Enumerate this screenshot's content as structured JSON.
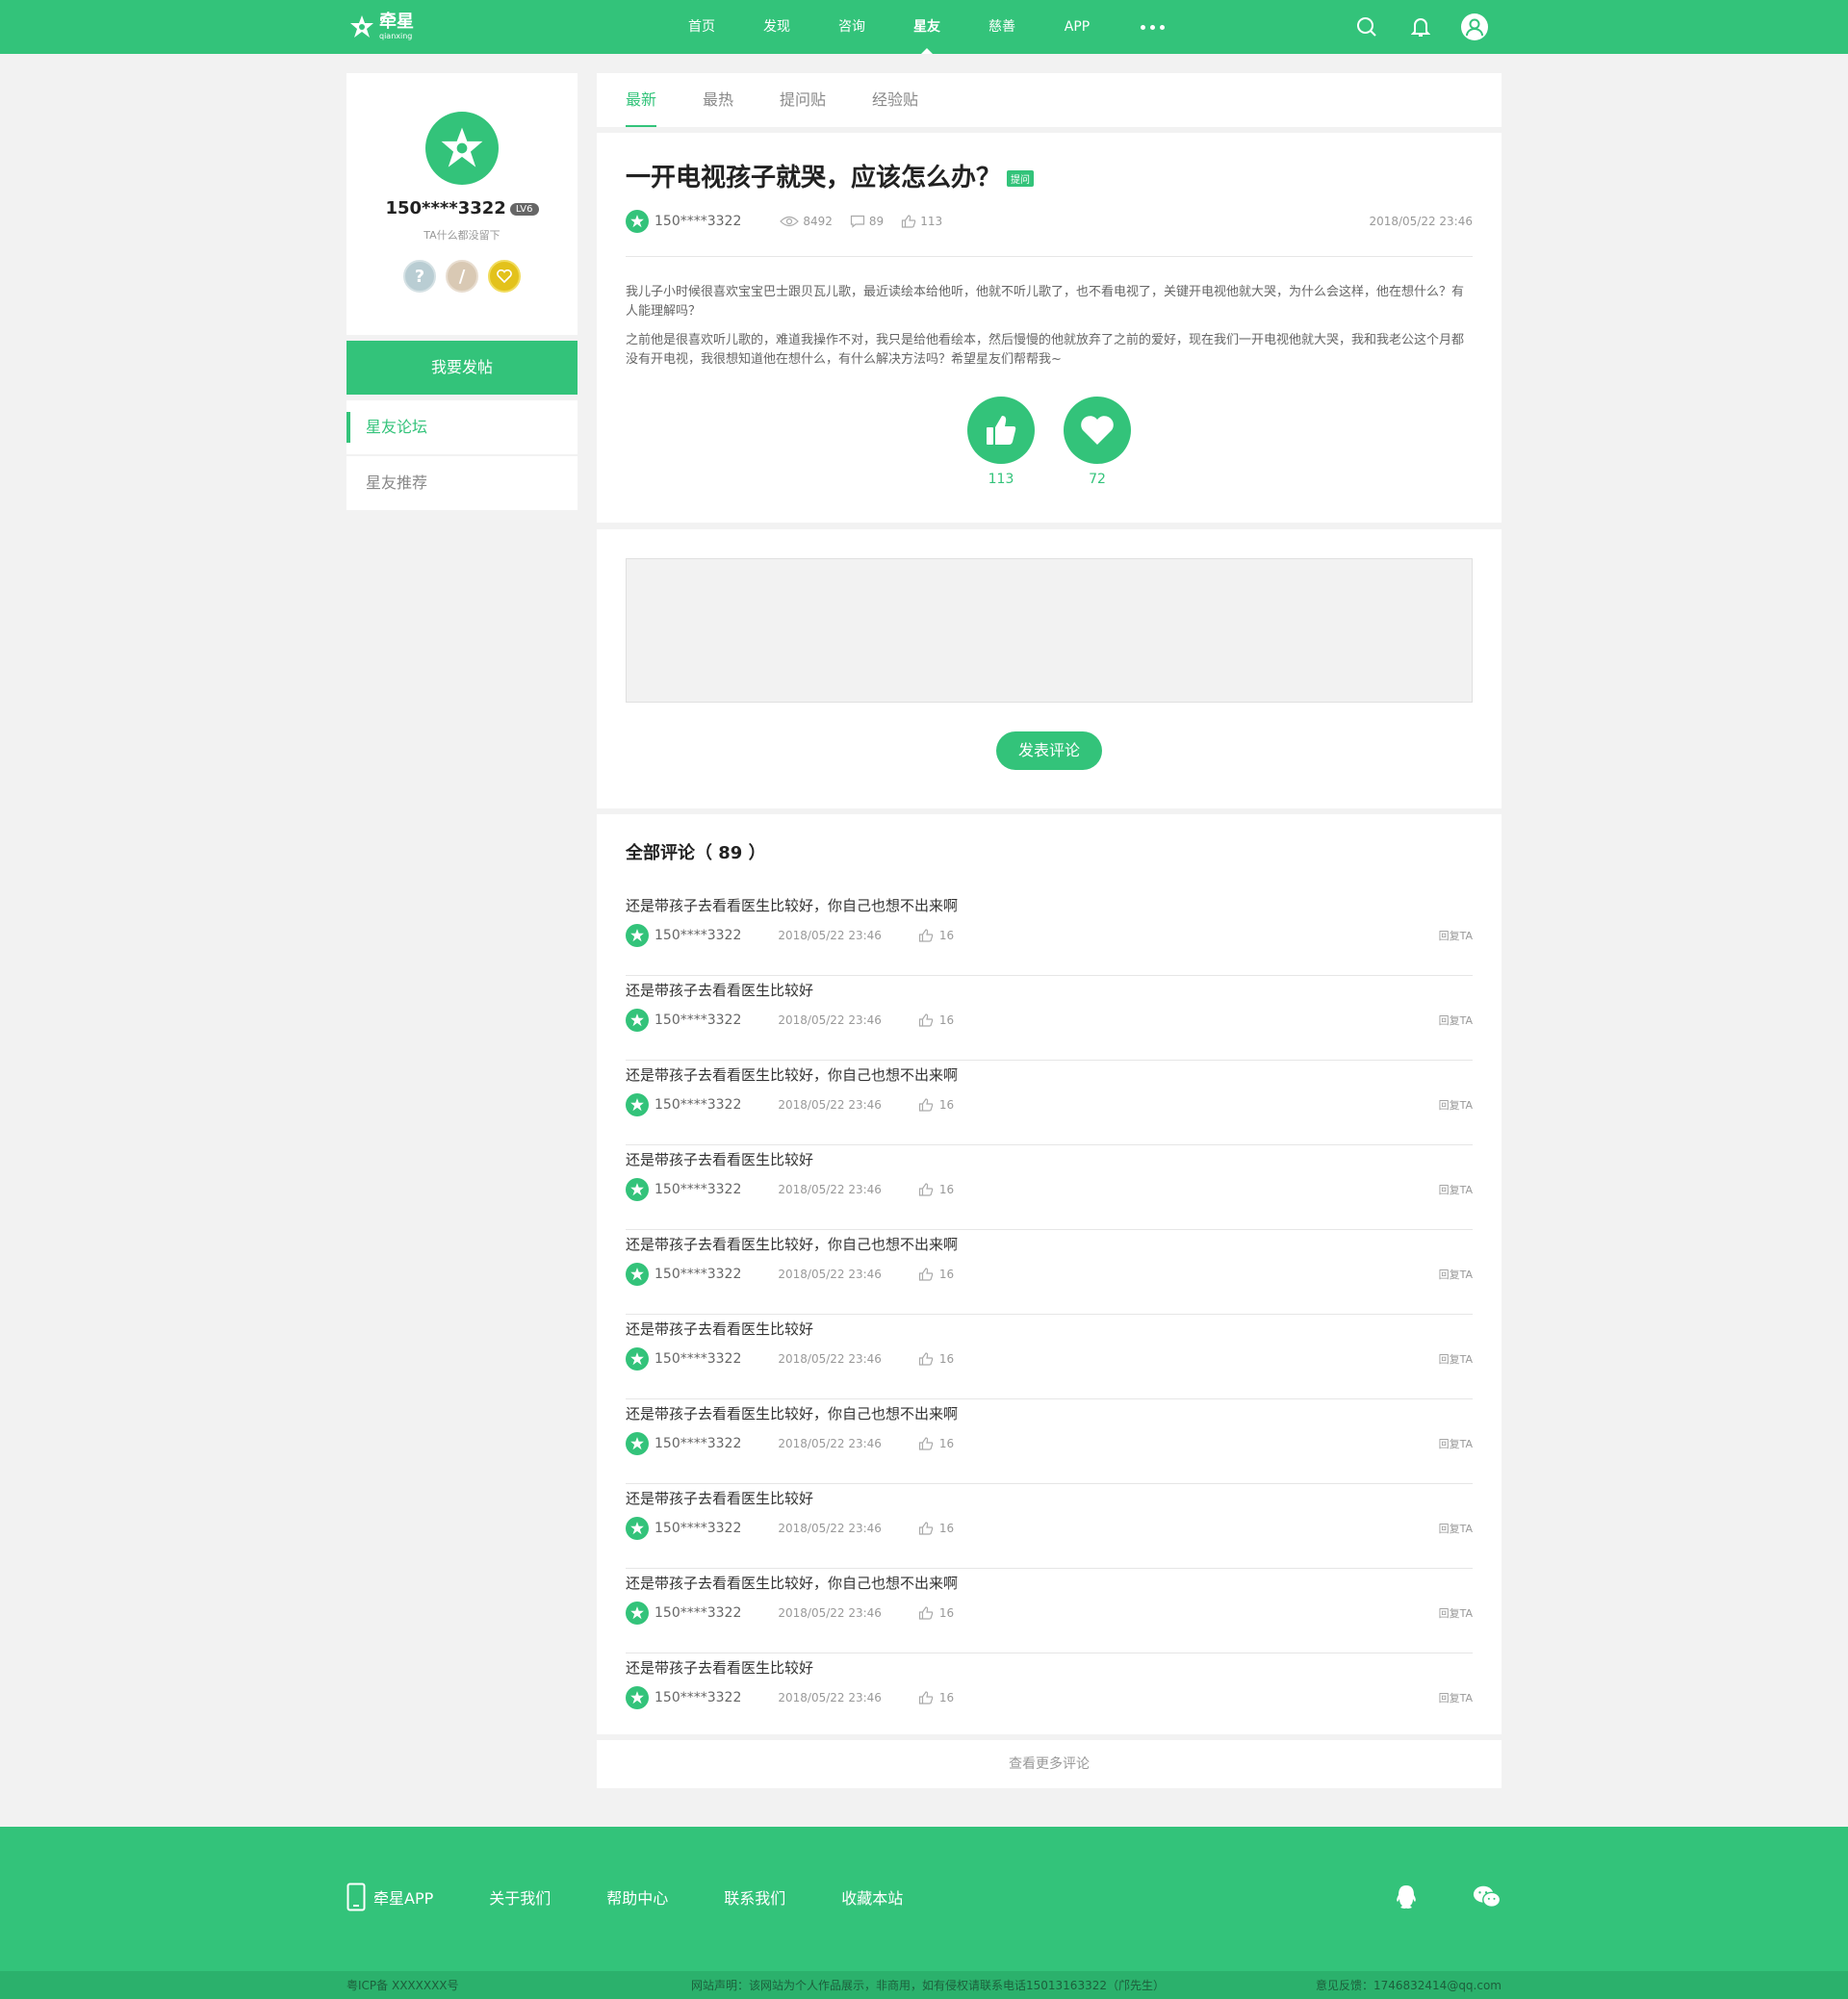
{
  "colors": {
    "accent": "#33c37a",
    "accent_dark": "#2bb16c",
    "page_bg": "#f2f2f2"
  },
  "header": {
    "logo_cn": "牵星",
    "logo_en": "qianxing",
    "nav": [
      "首页",
      "发现",
      "咨询",
      "星友",
      "慈善",
      "APP"
    ],
    "active_nav": "星友",
    "icons": [
      "search-icon",
      "bell-icon",
      "user-icon"
    ]
  },
  "sidebar": {
    "name": "150****3322",
    "level": "LV6",
    "sign": "TA什么都没留下",
    "medals": [
      "question-medal",
      "pencil-medal",
      "heart-medal"
    ],
    "post_button": "我要发帖",
    "menu": [
      {
        "label": "星友论坛",
        "active": true
      },
      {
        "label": "星友推荐",
        "active": false
      }
    ]
  },
  "tabs": [
    {
      "label": "最新",
      "active": true
    },
    {
      "label": "最热",
      "active": false
    },
    {
      "label": "提问贴",
      "active": false
    },
    {
      "label": "经验贴",
      "active": false
    }
  ],
  "post": {
    "title": "一开电视孩子就哭，应该怎么办？",
    "tag": "提问",
    "author": "150****3322",
    "views": "8492",
    "comments": "89",
    "likes": "113",
    "date": "2018/05/22  23:46",
    "body": [
      "我儿子小时候很喜欢宝宝巴士跟贝瓦儿歌，最近读绘本给他听，他就不听儿歌了，也不看电视了，关键开电视他就大哭，为什么会这样，他在想什么？有人能理解吗？",
      "之前他是很喜欢听儿歌的，难道我操作不对，我只是给他看绘本，然后慢慢的他就放弃了之前的爱好，现在我们一开电视他就大哭，我和我老公这个月都没有开电视，我很想知道他在想什么，有什么解决方法吗？希望星友们帮帮我~"
    ],
    "like_count": "113",
    "fav_count": "72"
  },
  "comment_box": {
    "placeholder": "",
    "submit": "发表评论"
  },
  "comments": {
    "title": "全部评论（ 89 ）",
    "items": [
      {
        "text": "还是带孩子去看看医生比较好，你自己也想不出来啊",
        "user": "150****3322",
        "time": "2018/05/22  23:46",
        "likes": "16",
        "reply": "回复TA"
      },
      {
        "text": "还是带孩子去看看医生比较好",
        "user": "150****3322",
        "time": "2018/05/22  23:46",
        "likes": "16",
        "reply": "回复TA"
      },
      {
        "text": "还是带孩子去看看医生比较好，你自己也想不出来啊",
        "user": "150****3322",
        "time": "2018/05/22  23:46",
        "likes": "16",
        "reply": "回复TA"
      },
      {
        "text": "还是带孩子去看看医生比较好",
        "user": "150****3322",
        "time": "2018/05/22  23:46",
        "likes": "16",
        "reply": "回复TA"
      },
      {
        "text": "还是带孩子去看看医生比较好，你自己也想不出来啊",
        "user": "150****3322",
        "time": "2018/05/22  23:46",
        "likes": "16",
        "reply": "回复TA"
      },
      {
        "text": "还是带孩子去看看医生比较好",
        "user": "150****3322",
        "time": "2018/05/22  23:46",
        "likes": "16",
        "reply": "回复TA"
      },
      {
        "text": "还是带孩子去看看医生比较好，你自己也想不出来啊",
        "user": "150****3322",
        "time": "2018/05/22  23:46",
        "likes": "16",
        "reply": "回复TA"
      },
      {
        "text": "还是带孩子去看看医生比较好",
        "user": "150****3322",
        "time": "2018/05/22  23:46",
        "likes": "16",
        "reply": "回复TA"
      },
      {
        "text": "还是带孩子去看看医生比较好，你自己也想不出来啊",
        "user": "150****3322",
        "time": "2018/05/22  23:46",
        "likes": "16",
        "reply": "回复TA"
      },
      {
        "text": "还是带孩子去看看医生比较好",
        "user": "150****3322",
        "time": "2018/05/22  23:46",
        "likes": "16",
        "reply": "回复TA"
      }
    ],
    "more": "查看更多评论"
  },
  "footer": {
    "links": [
      "牵星APP",
      "关于我们",
      "帮助中心",
      "联系我们",
      "收藏本站"
    ],
    "icons": [
      "qq-icon",
      "wechat-icon"
    ],
    "icp": "粤ICP备 XXXXXXX号",
    "statement": "网站声明：该网站为个人作品展示，非商用，如有侵权请联系电话15013163322（邝先生）",
    "feedback": "意见反馈：1746832414@qq.com"
  }
}
